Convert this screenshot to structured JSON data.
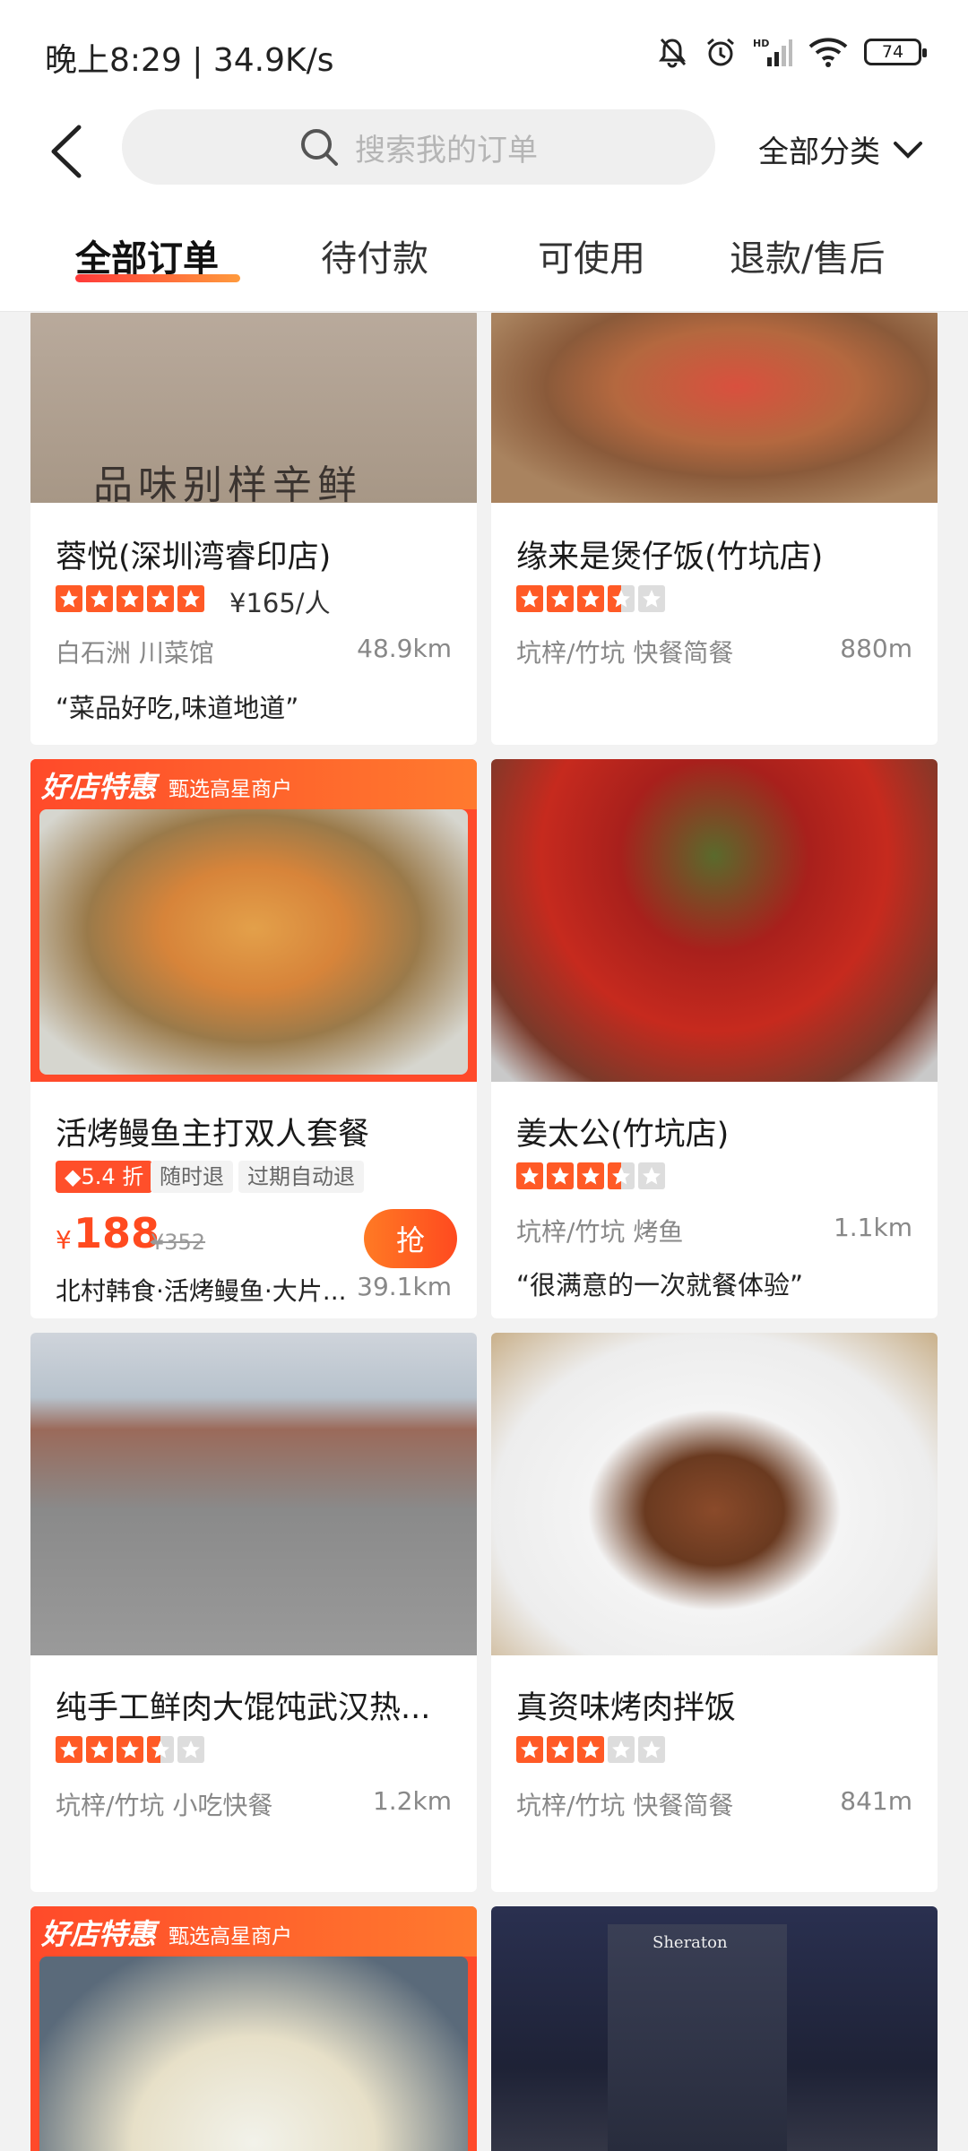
{
  "status_bar": {
    "time": "晚上8:29 | 34.9K/s",
    "battery": "74"
  },
  "header": {
    "search_placeholder": "搜索我的订单",
    "category": "全部分类"
  },
  "tabs": [
    {
      "label": "全部订单",
      "active": true
    },
    {
      "label": "待付款",
      "active": false
    },
    {
      "label": "可使用",
      "active": false
    },
    {
      "label": "退款/售后",
      "active": false
    }
  ],
  "cards": [
    {
      "title": "蓉悦(深圳湾睿印店)",
      "rating": 5,
      "price_per": "¥165/人",
      "meta": "白石洲 川菜馆",
      "distance": "48.9km",
      "quote": "“菜品好吃,味道地道”",
      "image_text": "品味别样辛鲜"
    },
    {
      "title": "缘来是煲仔饭(竹坑店)",
      "rating": 3.5,
      "meta": "坑梓/竹坑 快餐简餐",
      "distance": "880m"
    },
    {
      "title": "活烤鳗鱼主打双人套餐",
      "promo_banner": "好店特惠",
      "promo_sub": "甄选高星商户",
      "discount": "5.4 折",
      "tag1": "随时退",
      "tag2": "过期自动退",
      "currency": "¥",
      "price": "188",
      "original_price": "¥352",
      "grab_label": "抢",
      "shop_line": "北村韩食·活烤鳗鱼·大片...",
      "distance": "39.1km"
    },
    {
      "title": "姜太公(竹坑店)",
      "rating": 3.5,
      "meta": "坑梓/竹坑 烤鱼",
      "distance": "1.1km",
      "quote": "“很满意的一次就餐体验”"
    },
    {
      "title": "纯手工鲜肉大馄饨武汉热...",
      "rating": 3.5,
      "meta": "坑梓/竹坑 小吃快餐",
      "distance": "1.2km"
    },
    {
      "title": "真资味烤肉拌饭",
      "rating": 3,
      "meta": "坑梓/竹坑 快餐简餐",
      "distance": "841m"
    },
    {
      "promo_banner": "好店特惠",
      "promo_sub": "甄选高星商户"
    },
    {
      "image_text": "Sheraton"
    }
  ],
  "colors": {
    "accent": "#ff4a1f",
    "star": "#ff5a26"
  }
}
